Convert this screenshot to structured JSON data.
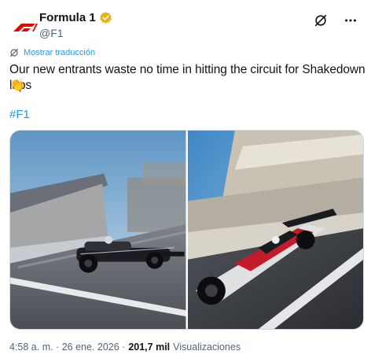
{
  "author": {
    "display_name": "Formula 1",
    "handle": "@F1",
    "avatar_icon": "f1-logo-icon",
    "verified_color": "#e2b719"
  },
  "actions": {
    "grok_icon": "grok-icon",
    "more_icon": "more-icon"
  },
  "translate_label": "Mostrar traducción",
  "tweet": {
    "text": "Our new entrants waste no time in hitting the circuit for Shakedown laps",
    "emoji": "👏",
    "hashtag": "#F1"
  },
  "media": [
    {
      "alt": "Black Formula 1 car on track in front of grandstand"
    },
    {
      "alt": "White and red Formula 1 car speeding past pit building"
    }
  ],
  "meta": {
    "timestamp": "4:58 a. m. · 26 ene. 2026 ·",
    "views_count": "201,7 mil",
    "views_label": "Visualizaciones"
  },
  "colors": {
    "accent": "#1d9bf0",
    "text": "#0f1419",
    "muted": "#536471"
  }
}
